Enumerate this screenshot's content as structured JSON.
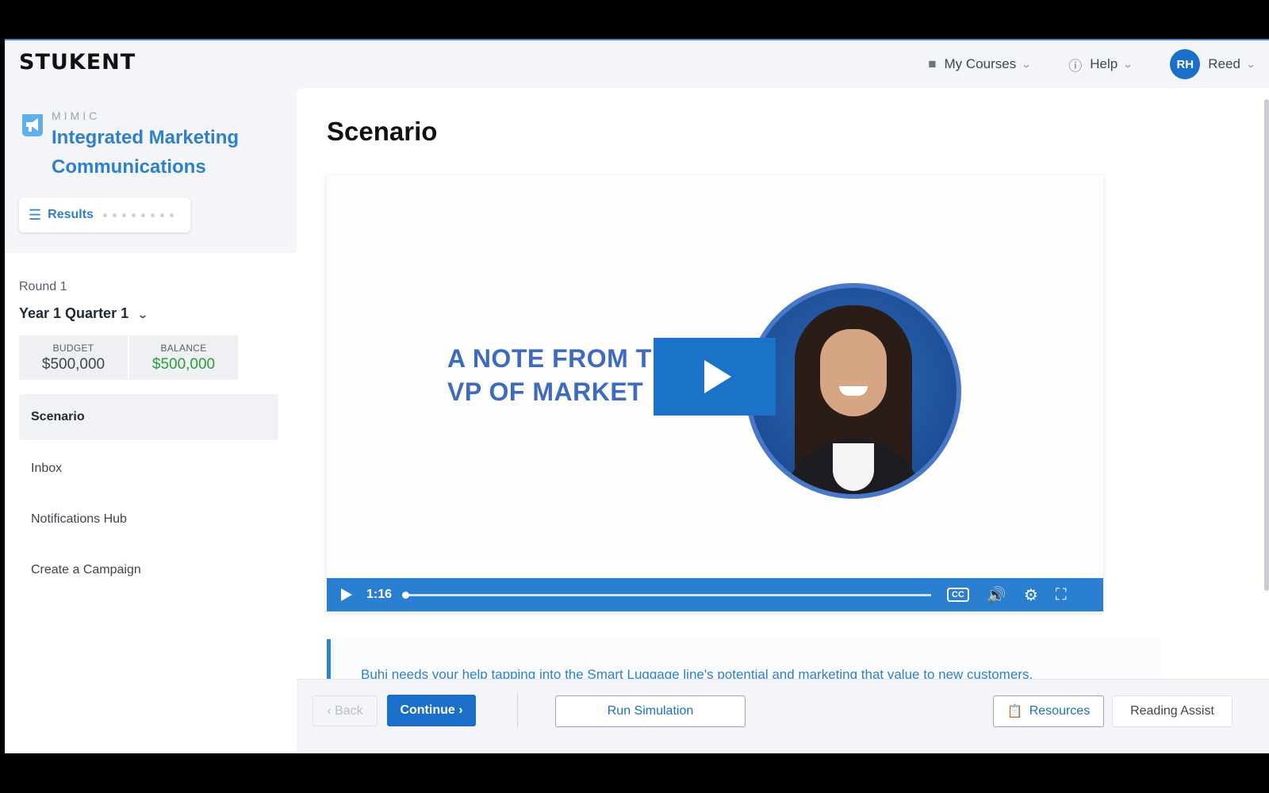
{
  "header": {
    "logo": "STUKENT",
    "my_courses": "My Courses",
    "help": "Help",
    "avatar_initials": "RH",
    "user_name": "Reed"
  },
  "sidebar": {
    "product_label": "MIMIC",
    "course_title": "Integrated Marketing Communications",
    "results_label": "Results",
    "round_label": "Round 1",
    "quarter_label": "Year 1 Quarter 1",
    "budget_label": "BUDGET",
    "budget_value": "$500,000",
    "balance_label": "BALANCE",
    "balance_value": "$500,000",
    "menu": [
      {
        "label": "Scenario",
        "active": true
      },
      {
        "label": "Inbox",
        "active": false
      },
      {
        "label": "Notifications Hub",
        "active": false
      },
      {
        "label": "Create a Campaign",
        "active": false
      }
    ]
  },
  "main": {
    "title": "Scenario",
    "video": {
      "overlay_line1": "A NOTE FROM T",
      "overlay_line2": "VP OF MARKET",
      "time": "1:16",
      "cc_label": "CC",
      "progress": 0.0
    },
    "intro_text": "Buhi needs your help tapping into the Smart Luggage line's potential and marketing that value to new customers."
  },
  "footer": {
    "back_label": "‹ Back",
    "continue_label": "Continue ›",
    "run_label": "Run Simulation",
    "resources_label": "Resources",
    "reading_label": "Reading Assist"
  },
  "colors": {
    "accent": "#1b6fc9",
    "title_blue": "#2e80c8",
    "balance_green": "#2f9a3d",
    "video_bar": "#2a7fd0"
  }
}
